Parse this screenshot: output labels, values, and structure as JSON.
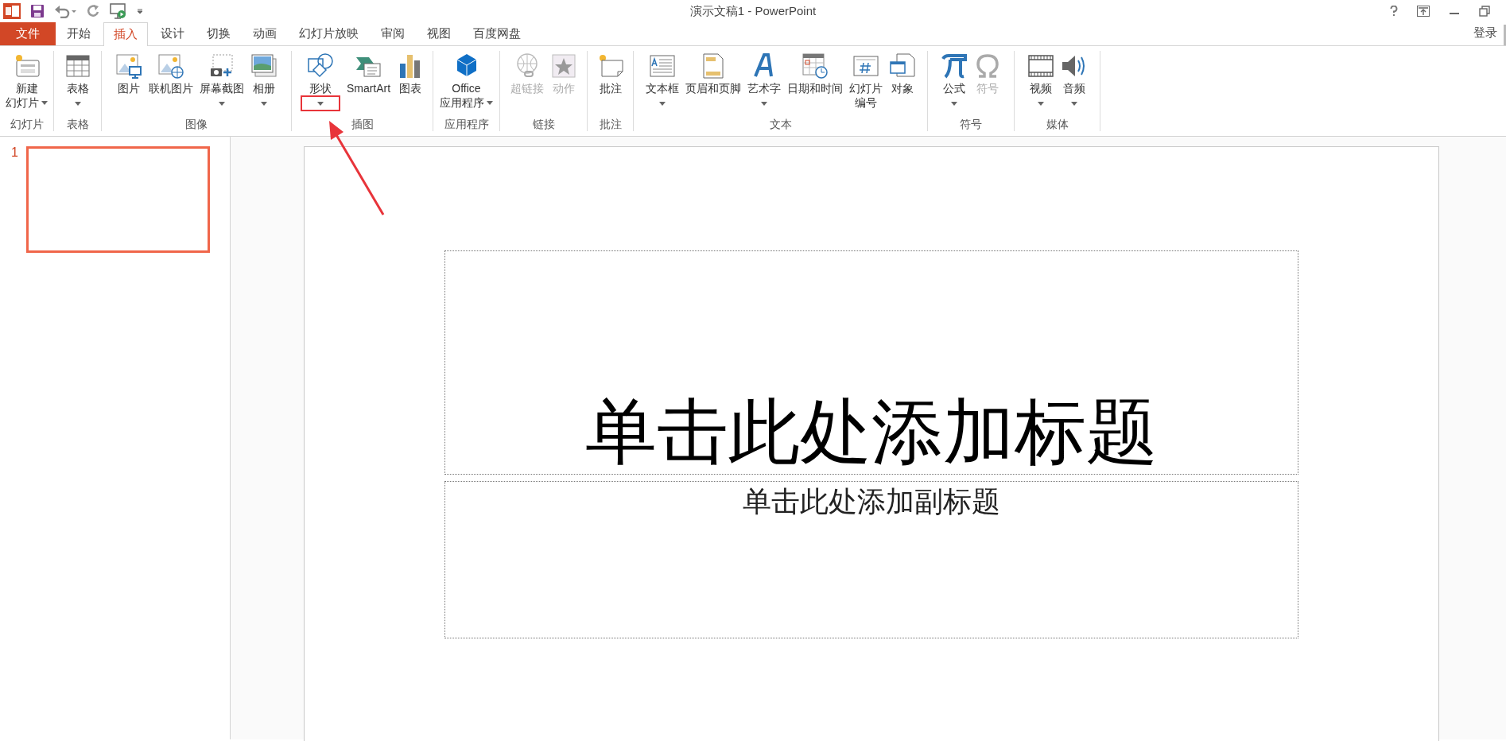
{
  "window": {
    "title": "演示文稿1 - PowerPoint"
  },
  "tabs": [
    {
      "label": "文件",
      "kind": "file",
      "selected": false
    },
    {
      "label": "开始",
      "kind": "tab",
      "selected": false
    },
    {
      "label": "插入",
      "kind": "tab",
      "selected": true
    },
    {
      "label": "设计",
      "kind": "tab",
      "selected": false
    },
    {
      "label": "切换",
      "kind": "tab",
      "selected": false
    },
    {
      "label": "动画",
      "kind": "tab",
      "selected": false
    },
    {
      "label": "幻灯片放映",
      "kind": "tab",
      "selected": false
    },
    {
      "label": "审阅",
      "kind": "tab",
      "selected": false
    },
    {
      "label": "视图",
      "kind": "tab",
      "selected": false
    },
    {
      "label": "百度网盘",
      "kind": "tab",
      "selected": false
    }
  ],
  "account": {
    "label": "登录"
  },
  "ribbon_groups": [
    {
      "label": "幻灯片",
      "buttons": [
        {
          "lines": [
            "新建",
            "幻灯片"
          ],
          "dropdown": true,
          "disabled": false
        }
      ]
    },
    {
      "label": "表格",
      "buttons": [
        {
          "lines": [
            "表格"
          ],
          "dropdown": true,
          "disabled": false
        }
      ]
    },
    {
      "label": "图像",
      "buttons": [
        {
          "lines": [
            "图片"
          ],
          "disabled": false
        },
        {
          "lines": [
            "联机图片"
          ],
          "disabled": false
        },
        {
          "lines": [
            "屏幕截图"
          ],
          "dropdown": true,
          "disabled": false
        },
        {
          "lines": [
            "相册"
          ],
          "dropdown": true,
          "disabled": false
        }
      ]
    },
    {
      "label": "插图",
      "buttons": [
        {
          "lines": [
            "形状"
          ],
          "dropdown": true,
          "disabled": false,
          "highlighted": true
        },
        {
          "lines": [
            "SmartArt"
          ],
          "disabled": false
        },
        {
          "lines": [
            "图表"
          ],
          "disabled": false
        }
      ]
    },
    {
      "label": "应用程序",
      "buttons": [
        {
          "lines": [
            "Office",
            "应用程序"
          ],
          "dropdown": true,
          "disabled": false
        }
      ]
    },
    {
      "label": "链接",
      "buttons": [
        {
          "lines": [
            "超链接"
          ],
          "disabled": true
        },
        {
          "lines": [
            "动作"
          ],
          "disabled": true
        }
      ]
    },
    {
      "label": "批注",
      "buttons": [
        {
          "lines": [
            "批注"
          ],
          "disabled": false
        }
      ]
    },
    {
      "label": "文本",
      "buttons": [
        {
          "lines": [
            "文本框"
          ],
          "dropdown": true,
          "disabled": false
        },
        {
          "lines": [
            "页眉和页脚"
          ],
          "disabled": false
        },
        {
          "lines": [
            "艺术字"
          ],
          "dropdown": true,
          "disabled": false
        },
        {
          "lines": [
            "日期和时间"
          ],
          "disabled": false
        },
        {
          "lines": [
            "幻灯片",
            "编号"
          ],
          "disabled": false
        },
        {
          "lines": [
            "对象"
          ],
          "disabled": false
        }
      ]
    },
    {
      "label": "符号",
      "buttons": [
        {
          "lines": [
            "公式"
          ],
          "dropdown": true,
          "disabled": false
        },
        {
          "lines": [
            "符号"
          ],
          "disabled": true
        }
      ]
    },
    {
      "label": "媒体",
      "buttons": [
        {
          "lines": [
            "视频"
          ],
          "dropdown": true,
          "disabled": false
        },
        {
          "lines": [
            "音频"
          ],
          "dropdown": true,
          "disabled": false
        }
      ]
    }
  ],
  "slides": [
    {
      "number": "1",
      "selected": true
    }
  ],
  "slide": {
    "title_placeholder": "单击此处添加标题",
    "subtitle_placeholder": "单击此处添加副标题"
  }
}
